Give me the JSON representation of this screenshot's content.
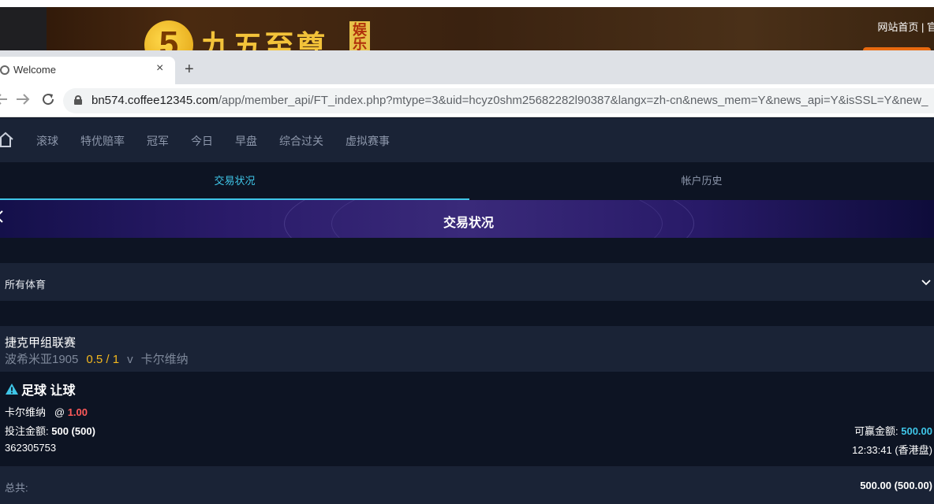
{
  "banner": {
    "logo_digit": "5",
    "logo_text": "九五至尊",
    "logo_tag": "娱乐",
    "links": "网站首页 | 官"
  },
  "browser": {
    "tab_title": "Welcome",
    "tab_close": "×",
    "new_tab": "+",
    "url_host": "bn574.coffee12345.com",
    "url_path": "/app/member_api/FT_index.php?mtype=3&uid=hcyz0shm25682282l90387&langx=zh-cn&news_mem=Y&news_api=Y&isSSL=Y&new_"
  },
  "nav": {
    "items": [
      "滚球",
      "特优赔率",
      "冠军",
      "今日",
      "早盘",
      "综合过关",
      "虚拟赛事"
    ]
  },
  "subtabs": {
    "active": "交易状况",
    "inactive": "帐户历史"
  },
  "hero": {
    "title": "交易状况"
  },
  "filter": {
    "selected": "所有体育"
  },
  "match": {
    "league": "捷克甲组联赛",
    "home": "波希米亚1905",
    "handicap": "0.5 / 1",
    "vs": "v",
    "away": "卡尔维纳"
  },
  "bet": {
    "title": "足球 让球",
    "pick_team": "卡尔维纳",
    "at": "@",
    "odds": "1.00",
    "stake_label": "投注金额:",
    "stake_value": "500 (500)",
    "ticket_id": "362305753",
    "win_label": "可赢金额:",
    "win_value": "500.00",
    "time": "12:33:41 (香港盘)"
  },
  "total": {
    "label": "总共:",
    "value": "500.00 (500.00)"
  },
  "colors": {
    "accent": "#3fc6e8",
    "handicap": "#f4b81e",
    "odds": "#ff5a5a",
    "panel": "#1a2336",
    "bg": "#0d1423"
  }
}
